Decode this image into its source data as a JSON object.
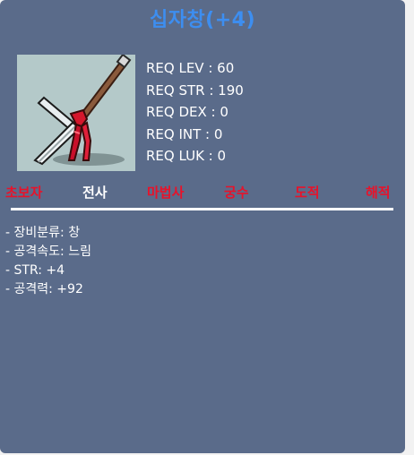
{
  "item": {
    "title": "십자창(+4)",
    "icon": "crossed-spear-icon"
  },
  "requirements": [
    {
      "label": "REQ LEV : 60"
    },
    {
      "label": "REQ STR : 190"
    },
    {
      "label": "REQ DEX : 0"
    },
    {
      "label": "REQ INT : 0"
    },
    {
      "label": "REQ LUK : 0"
    }
  ],
  "jobs": [
    {
      "label": "초보자",
      "color": "#e8122a"
    },
    {
      "label": "전사",
      "color": "#ffffff"
    },
    {
      "label": "마법사",
      "color": "#e8122a"
    },
    {
      "label": "궁수",
      "color": "#e8122a"
    },
    {
      "label": "도적",
      "color": "#e8122a"
    },
    {
      "label": "해적",
      "color": "#e8122a"
    }
  ],
  "stats": [
    {
      "label": "- 장비분류: 창"
    },
    {
      "label": "- 공격속도: 느림"
    },
    {
      "label": "- STR: +4"
    },
    {
      "label": "- 공격력: +92"
    }
  ],
  "colors": {
    "panel_background": "#5a6b8a",
    "title": "#3d8ef0",
    "unavailable_job": "#e8122a",
    "available_job": "#ffffff"
  }
}
